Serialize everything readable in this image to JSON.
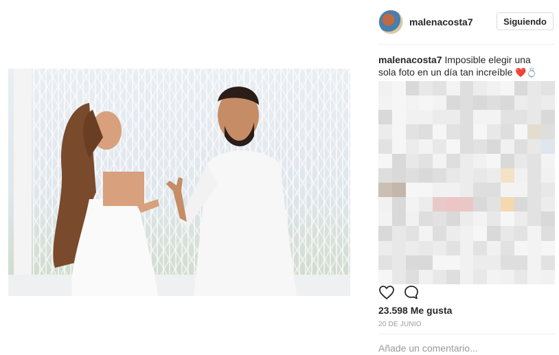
{
  "post": {
    "username": "malenacosta7",
    "follow_label": "Siguiendo",
    "caption_user": "malenacosta7",
    "caption_text": "Imposible elegir una sola foto en un día tan increíble",
    "caption_emoji": "❤️💍",
    "likes": "23.598 Me gusta",
    "date": "20 DE JUNIO",
    "comment_placeholder": "Añade un comentario..."
  },
  "icons": {
    "like": "heart-outline-icon",
    "comment": "speech-bubble-icon",
    "avatar": "profile-avatar"
  },
  "colors": {
    "text": "#262626",
    "muted": "#999999",
    "border": "#dbdbdb"
  }
}
